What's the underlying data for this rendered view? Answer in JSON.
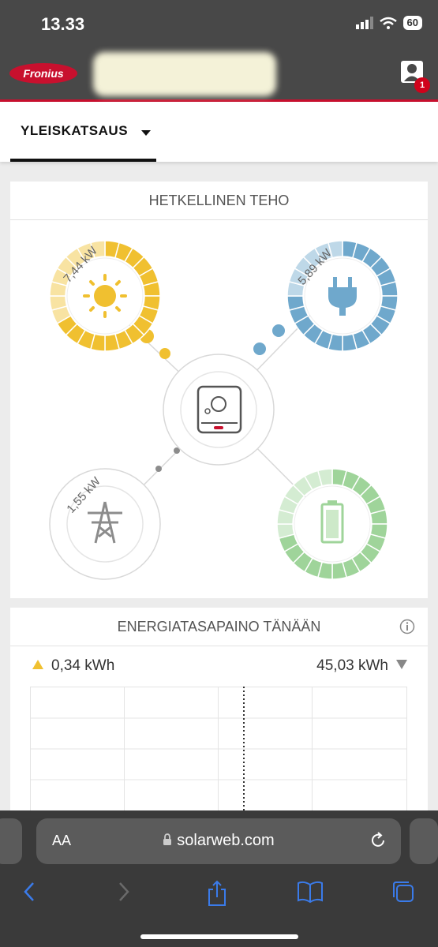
{
  "status_bar": {
    "time": "13.33",
    "battery": "60"
  },
  "app_bar": {
    "logo_text": "Fronius",
    "notification_count": "1"
  },
  "tabs": {
    "active_label": "YLEISKATSAUS"
  },
  "power_flow": {
    "title": "HETKELLINEN TEHO",
    "pv": {
      "value": "7,44 kW",
      "color": "#f0c030",
      "level": 0.65
    },
    "load": {
      "value": "5,89 kW",
      "color": "#6fa8cc",
      "level": 0.75
    },
    "grid": {
      "value": "1,55 kW",
      "color": "#909090"
    },
    "battery": {
      "color": "#9fd49a",
      "level": 0.7
    }
  },
  "energy_balance": {
    "title": "ENERGIATASAPAINO TÄNÄÄN",
    "produced": "0,34 kWh",
    "consumed": "45,03 kWh"
  },
  "browser": {
    "text_size": "AA",
    "url": "solarweb.com"
  }
}
